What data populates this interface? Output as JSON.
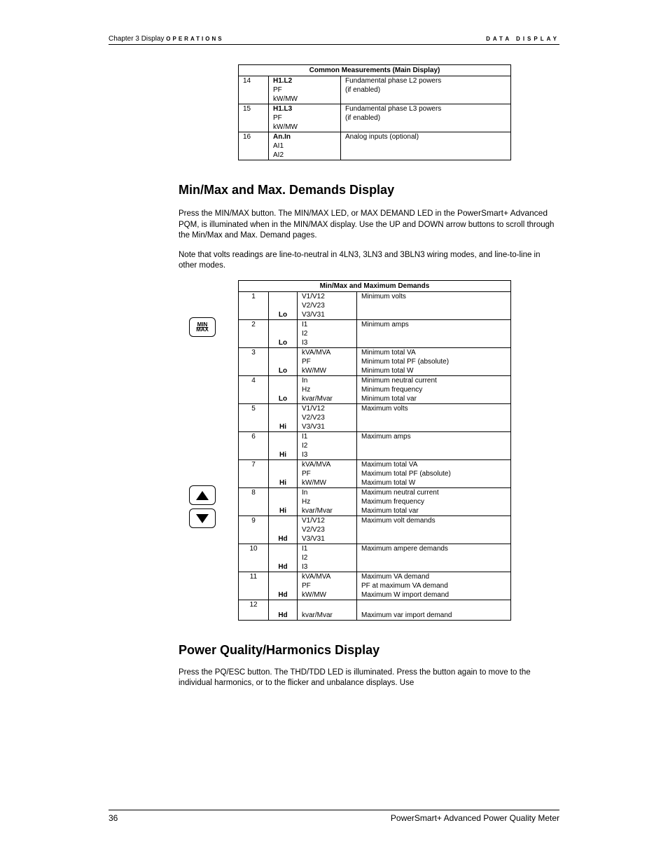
{
  "header": {
    "chapter": "Chapter 3  Display",
    "operations": "OPERATIONS",
    "right": "DATA DISPLAY"
  },
  "table1": {
    "title": "Common Measurements (Main Display)",
    "rows": [
      {
        "n": "14",
        "c1a": "H1.L2",
        "c1b": "PF",
        "c1c": "kW/MW",
        "c2a": "Fundamental phase L2 powers",
        "c2b": "(if enabled)",
        "c2c": ""
      },
      {
        "n": "15",
        "c1a": "H1.L3",
        "c1b": "PF",
        "c1c": "kW/MW",
        "c2a": "Fundamental phase L3 powers",
        "c2b": "(if enabled)",
        "c2c": ""
      },
      {
        "n": "16",
        "c1a": "An.In",
        "c1b": "AI1",
        "c1c": "AI2",
        "c2a": "Analog inputs (optional)",
        "c2b": "",
        "c2c": ""
      }
    ]
  },
  "sec1": {
    "title": "Min/Max and Max. Demands Display",
    "p1": "Press the MIN/MAX button. The MIN/MAX LED, or MAX DEMAND LED in the ",
    "brand": "PowerSmart+ Advanced",
    "p1b": " PQM, is illuminated when in the MIN/MAX display. Use the UP and DOWN arrow buttons to scroll through the Min/Max and Max. Demand pages.",
    "p2": "Note that volts readings are line-to-neutral in 4LN3, 3LN3 and 3BLN3 wiring modes, and line-to-line in other modes."
  },
  "btn": {
    "min": "MIN",
    "max": "MAX"
  },
  "table2": {
    "title": "Min/Max and Maximum Demands",
    "rows": [
      {
        "n": "1",
        "ind": "Lo",
        "l": [
          "V1/V12",
          "V2/V23",
          "V3/V31"
        ],
        "d": [
          "Minimum volts",
          "",
          ""
        ]
      },
      {
        "n": "2",
        "ind": "Lo",
        "l": [
          "I1",
          "I2",
          "I3"
        ],
        "d": [
          "Minimum amps",
          "",
          ""
        ]
      },
      {
        "n": "3",
        "ind": "Lo",
        "l": [
          "kVA/MVA",
          "PF",
          "kW/MW"
        ],
        "d": [
          "Minimum total VA",
          "Minimum total PF (absolute)",
          "Minimum total W"
        ]
      },
      {
        "n": "4",
        "ind": "Lo",
        "l": [
          "In",
          "Hz",
          "kvar/Mvar"
        ],
        "d": [
          "Minimum neutral current",
          "Minimum frequency",
          "Minimum total var"
        ]
      },
      {
        "n": "5",
        "ind": "Hi",
        "l": [
          "V1/V12",
          "V2/V23",
          "V3/V31"
        ],
        "d": [
          "Maximum volts",
          "",
          ""
        ]
      },
      {
        "n": "6",
        "ind": "Hi",
        "l": [
          "I1",
          "I2",
          "I3"
        ],
        "d": [
          "Maximum amps",
          "",
          ""
        ]
      },
      {
        "n": "7",
        "ind": "Hi",
        "l": [
          "kVA/MVA",
          "PF",
          "kW/MW"
        ],
        "d": [
          "Maximum total VA",
          "Maximum total PF (absolute)",
          "Maximum total W"
        ]
      },
      {
        "n": "8",
        "ind": "Hi",
        "l": [
          "In",
          "Hz",
          "kvar/Mvar"
        ],
        "d": [
          "Maximum neutral current",
          "Maximum frequency",
          "Maximum total var"
        ]
      },
      {
        "n": "9",
        "ind": "Hd",
        "l": [
          "V1/V12",
          "V2/V23",
          "V3/V31"
        ],
        "d": [
          "Maximum volt demands",
          "",
          ""
        ]
      },
      {
        "n": "10",
        "ind": "Hd",
        "l": [
          "I1",
          "I2",
          "I3"
        ],
        "d": [
          "Maximum ampere demands",
          "",
          ""
        ]
      },
      {
        "n": "11",
        "ind": "Hd",
        "l": [
          "kVA/MVA",
          "PF",
          "kW/MW"
        ],
        "d": [
          "Maximum VA demand",
          "PF at maximum VA demand",
          "Maximum W import demand"
        ]
      },
      {
        "n": "12",
        "ind": "Hd",
        "l": [
          "",
          "",
          "kvar/Mvar"
        ],
        "d": [
          "",
          "",
          "Maximum var import demand"
        ]
      }
    ]
  },
  "sec2": {
    "title": "Power Quality/Harmonics Display",
    "p1": "Press the PQ/ESC button. The THD/TDD LED is illuminated. Press the button again to move to the individual harmonics, or to the flicker and unbalance displays. Use"
  },
  "footer": {
    "page": "36",
    "title": "PowerSmart+ Advanced Power Quality Meter"
  }
}
